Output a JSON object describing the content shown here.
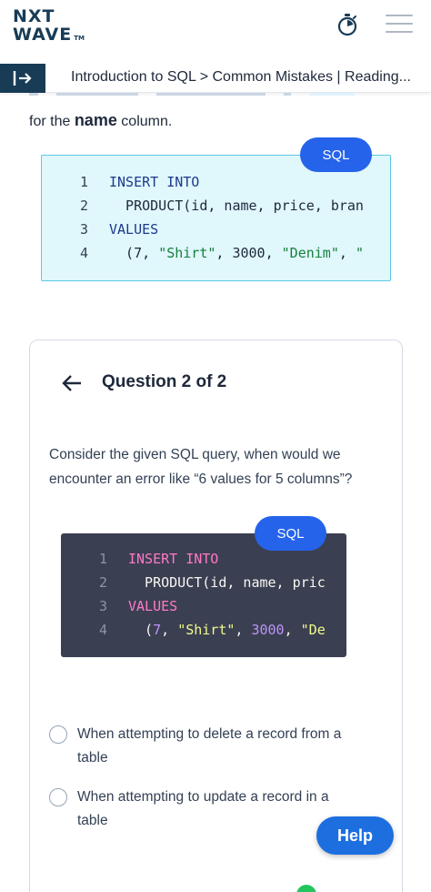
{
  "header": {
    "logo_line1": "NXT",
    "logo_line2": "WAVE",
    "logo_tm": "TM",
    "timer_icon": "stopwatch-icon",
    "menu_icon": "hamburger-icon"
  },
  "breadcrumb": {
    "collapse_icon": "collapse-sidebar-icon",
    "text": "Introduction to SQL > Common Mistakes | Reading..."
  },
  "reading": {
    "text_before": "for the ",
    "text_bold": "name",
    "text_after": " column.",
    "sql_label": "SQL",
    "code_lines": [
      {
        "num": "1",
        "segments": [
          {
            "t": "INSERT INTO",
            "c": "kw"
          }
        ]
      },
      {
        "num": "2",
        "segments": [
          {
            "t": "  PRODUCT(id, name, price, bran",
            "c": "id"
          }
        ]
      },
      {
        "num": "3",
        "segments": [
          {
            "t": "VALUES",
            "c": "kw"
          }
        ]
      },
      {
        "num": "4",
        "segments": [
          {
            "t": "  (7, ",
            "c": "id"
          },
          {
            "t": "\"Shirt\"",
            "c": "str"
          },
          {
            "t": ", ",
            "c": "id"
          },
          {
            "t": "3000",
            "c": "num"
          },
          {
            "t": ", ",
            "c": "id"
          },
          {
            "t": "\"Denim\"",
            "c": "str"
          },
          {
            "t": ", ",
            "c": "id"
          },
          {
            "t": "\"",
            "c": "str"
          }
        ]
      }
    ]
  },
  "question": {
    "count": "Question 2 of 2",
    "text": "Consider the given SQL query, when would we encounter an error like “6 values for 5 columns”?",
    "sql_label": "SQL",
    "code_lines": [
      {
        "num": "1",
        "segments": [
          {
            "t": "INSERT INTO",
            "c": "kw"
          }
        ]
      },
      {
        "num": "2",
        "segments": [
          {
            "t": "  PRODUCT(id, name, pric",
            "c": "id"
          }
        ]
      },
      {
        "num": "3",
        "segments": [
          {
            "t": "VALUES",
            "c": "kw"
          }
        ]
      },
      {
        "num": "4",
        "segments": [
          {
            "t": "  (",
            "c": "id"
          },
          {
            "t": "7",
            "c": "num"
          },
          {
            "t": ", ",
            "c": "id"
          },
          {
            "t": "\"Shirt\"",
            "c": "str"
          },
          {
            "t": ", ",
            "c": "id"
          },
          {
            "t": "3000",
            "c": "num"
          },
          {
            "t": ", ",
            "c": "id"
          },
          {
            "t": "\"De",
            "c": "str"
          }
        ]
      }
    ],
    "options": [
      "When attempting to delete a record from a table",
      "When attempting to update a record in a table"
    ]
  },
  "help_label": "Help",
  "colors": {
    "brand": "#183b56",
    "accent": "#2563eb"
  }
}
